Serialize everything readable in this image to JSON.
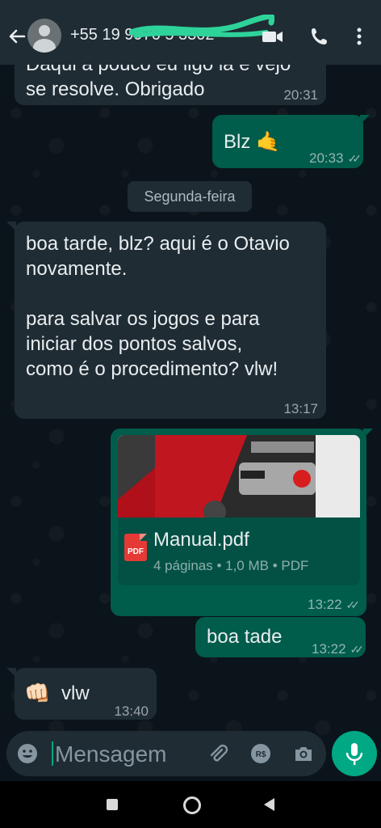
{
  "header": {
    "contact": "+55 19 9976 5 3302"
  },
  "messages": {
    "m1": {
      "text": "Daqui a pouco eu ligo lá e vejo\nse resolve. Obrigado",
      "time": "20:31"
    },
    "m2": {
      "text": "Blz 🤙",
      "time": "20:33"
    },
    "date_divider": "Segunda-feira",
    "m3": {
      "text": "boa tarde, blz? aqui é o Otavio\nnovamente.\n\npara salvar os jogos e para\niniciar dos pontos salvos,\ncomo é o procedimento? vlw!",
      "time": "13:17"
    },
    "m4": {
      "file_name": "Manual.pdf",
      "file_meta": "4 páginas • 1,0 MB • PDF",
      "icon_label": "PDF",
      "time": "13:22"
    },
    "m5": {
      "text": "boa tade",
      "time": "13:22"
    },
    "m6": {
      "emoji": "👊🏻",
      "text": "vlw",
      "time": "13:40"
    }
  },
  "input": {
    "placeholder": "Mensagem"
  },
  "icons": [
    "back-arrow-icon",
    "avatar-icon",
    "video-call-icon",
    "phone-icon",
    "more-options-icon",
    "emoji-icon",
    "attach-icon",
    "payment-icon",
    "camera-icon",
    "microphone-icon",
    "double-check-icon",
    "pdf-icon"
  ],
  "colors": {
    "header": "#1f2c34",
    "background": "#0b141a",
    "incoming_bubble": "#1f2c34",
    "outgoing_bubble": "#005c4b",
    "accent": "#00a884"
  }
}
